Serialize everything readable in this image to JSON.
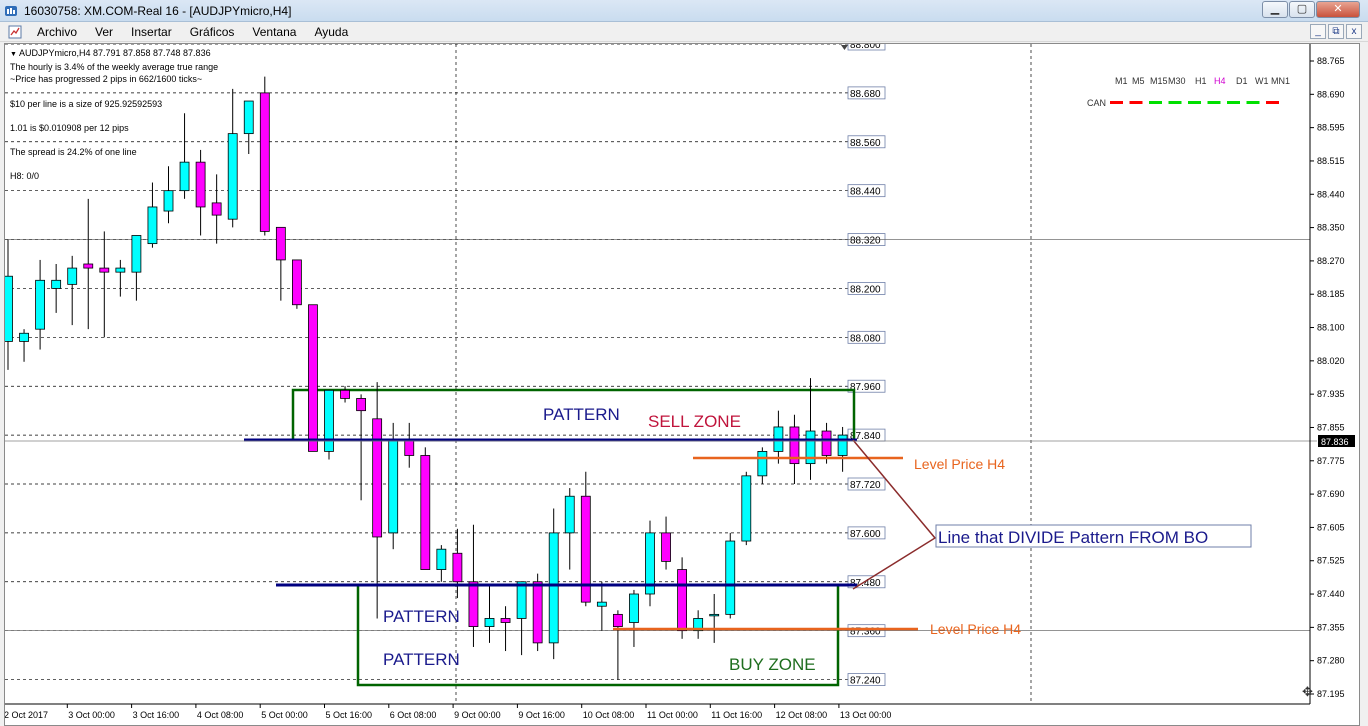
{
  "window": {
    "title": "16030758: XM.COM-Real 16 - [AUDJPYmicro,H4]",
    "buttons": {
      "minimize": "▁",
      "maximize": "▢",
      "close": "✕"
    }
  },
  "menu": {
    "items": [
      "Archivo",
      "Ver",
      "Insertar",
      "Gráficos",
      "Ventana",
      "Ayuda"
    ],
    "mdi": {
      "minimize": "_",
      "restore": "⧉",
      "close": "x"
    }
  },
  "chart_info": {
    "header": "AUDJPYmicro,H4  87.791 87.858 87.748 87.836",
    "lines": [
      "The hourly is 3.4% of the weekly average true range",
      "~Price has progressed  2  pips in 662/1600 ticks~",
      "$10 per line is a size of 925.92592593",
      "1.01 is $0.010908 per 12 pips",
      "The spread is 24.2% of one line",
      "H8: 0/0"
    ]
  },
  "timeframes": {
    "items": [
      "M1",
      "M5",
      "M15",
      "M30",
      "H1",
      "H4",
      "D1",
      "W1",
      "MN1"
    ],
    "active": "H4",
    "can_label": "CAN",
    "can_colors": [
      "#ff0000",
      "#ff0000",
      "#00e000",
      "#00e000",
      "#00e000",
      "#00e000",
      "#00e000",
      "#00e000",
      "#ff0000"
    ]
  },
  "colors": {
    "bull": "#00ffff",
    "bear": "#ff00ff",
    "zone_green": "#006400",
    "divide_line": "#000080",
    "level_orange": "#e8641e",
    "arrow_brown": "#8b2c2c",
    "text_blue": "#1a1a8c",
    "sell_red": "#c0143c",
    "buy_green": "#1e6e1e"
  },
  "chart_data": {
    "type": "candlestick",
    "symbol": "AUDJPYmicro",
    "timeframe": "H4",
    "ylim": [
      87.18,
      88.8
    ],
    "y_ticks": [
      "88.765",
      "88.690",
      "88.595",
      "88.515",
      "88.440",
      "88.350",
      "88.270",
      "88.185",
      "88.100",
      "88.020",
      "87.935",
      "87.855",
      "87.775",
      "87.690",
      "87.605",
      "87.525",
      "87.440",
      "87.355",
      "87.280",
      "87.195"
    ],
    "current_price": "87.836",
    "x_labels": [
      "2 Oct 2017",
      "3 Oct 00:00",
      "3 Oct 16:00",
      "4 Oct 08:00",
      "5 Oct 00:00",
      "5 Oct 16:00",
      "6 Oct 08:00",
      "9 Oct 00:00",
      "9 Oct 16:00",
      "10 Oct 08:00",
      "11 Oct 00:00",
      "11 Oct 16:00",
      "12 Oct 08:00",
      "13 Oct 00:00"
    ],
    "grid_levels": [
      "88.800",
      "88.680",
      "88.560",
      "88.440",
      "88.320",
      "88.200",
      "88.080",
      "87.960",
      "87.840",
      "87.720",
      "87.600",
      "87.480",
      "87.360",
      "87.240"
    ],
    "candles": [
      {
        "o": 88.07,
        "h": 88.32,
        "l": 88.0,
        "c": 88.23
      },
      {
        "o": 88.07,
        "h": 88.1,
        "l": 88.02,
        "c": 88.09
      },
      {
        "o": 88.1,
        "h": 88.27,
        "l": 88.05,
        "c": 88.22
      },
      {
        "o": 88.2,
        "h": 88.26,
        "l": 88.14,
        "c": 88.22
      },
      {
        "o": 88.21,
        "h": 88.28,
        "l": 88.11,
        "c": 88.25
      },
      {
        "o": 88.26,
        "h": 88.42,
        "l": 88.1,
        "c": 88.25
      },
      {
        "o": 88.25,
        "h": 88.34,
        "l": 88.08,
        "c": 88.24
      },
      {
        "o": 88.24,
        "h": 88.27,
        "l": 88.18,
        "c": 88.25
      },
      {
        "o": 88.24,
        "h": 88.33,
        "l": 88.17,
        "c": 88.33
      },
      {
        "o": 88.31,
        "h": 88.46,
        "l": 88.3,
        "c": 88.4
      },
      {
        "o": 88.39,
        "h": 88.5,
        "l": 88.36,
        "c": 88.44
      },
      {
        "o": 88.44,
        "h": 88.63,
        "l": 88.42,
        "c": 88.51
      },
      {
        "o": 88.51,
        "h": 88.54,
        "l": 88.33,
        "c": 88.4
      },
      {
        "o": 88.41,
        "h": 88.48,
        "l": 88.31,
        "c": 88.38
      },
      {
        "o": 88.37,
        "h": 88.69,
        "l": 88.35,
        "c": 88.58
      },
      {
        "o": 88.58,
        "h": 88.66,
        "l": 88.53,
        "c": 88.66
      },
      {
        "o": 88.68,
        "h": 88.72,
        "l": 88.33,
        "c": 88.34
      },
      {
        "o": 88.35,
        "h": 88.35,
        "l": 88.17,
        "c": 88.27
      },
      {
        "o": 88.27,
        "h": 88.27,
        "l": 88.15,
        "c": 88.16
      },
      {
        "o": 88.16,
        "h": 88.16,
        "l": 87.8,
        "c": 87.8
      },
      {
        "o": 87.8,
        "h": 87.95,
        "l": 87.78,
        "c": 87.95
      },
      {
        "o": 87.95,
        "h": 87.96,
        "l": 87.92,
        "c": 87.93
      },
      {
        "o": 87.93,
        "h": 87.94,
        "l": 87.68,
        "c": 87.9
      },
      {
        "o": 87.88,
        "h": 87.97,
        "l": 87.39,
        "c": 87.59
      },
      {
        "o": 87.6,
        "h": 87.87,
        "l": 87.56,
        "c": 87.83
      },
      {
        "o": 87.83,
        "h": 87.87,
        "l": 87.76,
        "c": 87.79
      },
      {
        "o": 87.79,
        "h": 87.81,
        "l": 87.51,
        "c": 87.51
      },
      {
        "o": 87.51,
        "h": 87.57,
        "l": 87.48,
        "c": 87.56
      },
      {
        "o": 87.55,
        "h": 87.61,
        "l": 87.44,
        "c": 87.48
      },
      {
        "o": 87.48,
        "h": 87.62,
        "l": 87.32,
        "c": 87.37
      },
      {
        "o": 87.37,
        "h": 87.47,
        "l": 87.33,
        "c": 87.39
      },
      {
        "o": 87.39,
        "h": 87.42,
        "l": 87.31,
        "c": 87.38
      },
      {
        "o": 87.39,
        "h": 87.48,
        "l": 87.3,
        "c": 87.48
      },
      {
        "o": 87.48,
        "h": 87.5,
        "l": 87.31,
        "c": 87.33
      },
      {
        "o": 87.33,
        "h": 87.66,
        "l": 87.29,
        "c": 87.6
      },
      {
        "o": 87.6,
        "h": 87.71,
        "l": 87.51,
        "c": 87.69
      },
      {
        "o": 87.69,
        "h": 87.75,
        "l": 87.42,
        "c": 87.43
      },
      {
        "o": 87.42,
        "h": 87.48,
        "l": 87.36,
        "c": 87.43
      },
      {
        "o": 87.4,
        "h": 87.41,
        "l": 87.24,
        "c": 87.37
      },
      {
        "o": 87.38,
        "h": 87.46,
        "l": 87.32,
        "c": 87.45
      },
      {
        "o": 87.45,
        "h": 87.63,
        "l": 87.42,
        "c": 87.6
      },
      {
        "o": 87.6,
        "h": 87.64,
        "l": 87.51,
        "c": 87.53
      },
      {
        "o": 87.51,
        "h": 87.54,
        "l": 87.34,
        "c": 87.36
      },
      {
        "o": 87.36,
        "h": 87.41,
        "l": 87.34,
        "c": 87.39
      },
      {
        "o": 87.4,
        "h": 87.45,
        "l": 87.33,
        "c": 87.4
      },
      {
        "o": 87.4,
        "h": 87.6,
        "l": 87.39,
        "c": 87.58
      },
      {
        "o": 87.58,
        "h": 87.75,
        "l": 87.57,
        "c": 87.74
      },
      {
        "o": 87.74,
        "h": 87.81,
        "l": 87.72,
        "c": 87.8
      },
      {
        "o": 87.8,
        "h": 87.9,
        "l": 87.77,
        "c": 87.86
      },
      {
        "o": 87.86,
        "h": 87.89,
        "l": 87.72,
        "c": 87.77
      },
      {
        "o": 87.77,
        "h": 87.98,
        "l": 87.73,
        "c": 87.85
      },
      {
        "o": 87.85,
        "h": 87.87,
        "l": 87.77,
        "c": 87.79
      },
      {
        "o": 87.79,
        "h": 87.86,
        "l": 87.75,
        "c": 87.84
      }
    ]
  },
  "annotations": {
    "pattern_top": "PATTERN",
    "sell_zone": "SELL ZONE",
    "pattern_mid": "PATTERN",
    "pattern_bottom": "PATTERN",
    "buy_zone": "BUY ZONE",
    "level_upper": "Level Price H4",
    "level_lower": "Level Price H4",
    "divide_note": "Line that DIVIDE Pattern FROM BO"
  }
}
